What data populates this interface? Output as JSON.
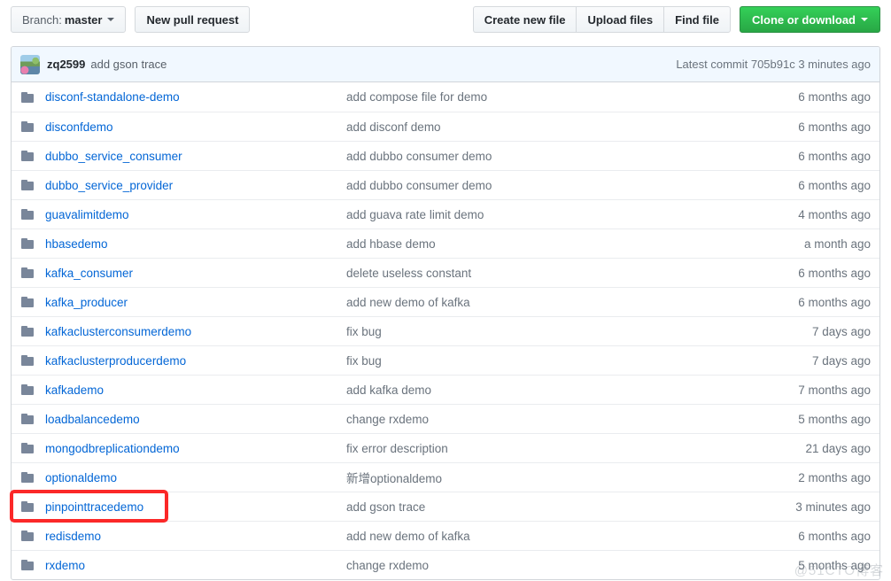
{
  "toolbar": {
    "branch_prefix": "Branch:",
    "branch_name": "master",
    "new_pull_request": "New pull request",
    "create_new_file": "Create new file",
    "upload_files": "Upload files",
    "find_file": "Find file",
    "clone_or_download": "Clone or download"
  },
  "commit_bar": {
    "author": "zq2599",
    "message": "add gson trace",
    "latest_commit_label": "Latest commit",
    "sha": "705b91c",
    "age": "3 minutes ago",
    "meta": "Latest commit 705b91c 3 minutes ago"
  },
  "files": [
    {
      "icon": "folder-icon",
      "name": "disconf-standalone-demo",
      "message": "add compose file for demo",
      "age": "6 months ago"
    },
    {
      "icon": "folder-icon",
      "name": "disconfdemo",
      "message": "add disconf demo",
      "age": "6 months ago"
    },
    {
      "icon": "folder-icon",
      "name": "dubbo_service_consumer",
      "message": "add dubbo consumer demo",
      "age": "6 months ago"
    },
    {
      "icon": "folder-icon",
      "name": "dubbo_service_provider",
      "message": "add dubbo consumer demo",
      "age": "6 months ago"
    },
    {
      "icon": "folder-icon",
      "name": "guavalimitdemo",
      "message": "add guava rate limit demo",
      "age": "4 months ago"
    },
    {
      "icon": "folder-icon",
      "name": "hbasedemo",
      "message": "add hbase demo",
      "age": "a month ago"
    },
    {
      "icon": "folder-icon",
      "name": "kafka_consumer",
      "message": "delete useless constant",
      "age": "6 months ago"
    },
    {
      "icon": "folder-icon",
      "name": "kafka_producer",
      "message": "add new demo of kafka",
      "age": "6 months ago"
    },
    {
      "icon": "folder-icon",
      "name": "kafkaclusterconsumerdemo",
      "message": "fix bug",
      "age": "7 days ago"
    },
    {
      "icon": "folder-icon",
      "name": "kafkaclusterproducerdemo",
      "message": "fix bug",
      "age": "7 days ago"
    },
    {
      "icon": "folder-icon",
      "name": "kafkademo",
      "message": "add kafka demo",
      "age": "7 months ago"
    },
    {
      "icon": "folder-icon",
      "name": "loadbalancedemo",
      "message": "change rxdemo",
      "age": "5 months ago"
    },
    {
      "icon": "folder-icon",
      "name": "mongodbreplicationdemo",
      "message": "fix error description",
      "age": "21 days ago"
    },
    {
      "icon": "folder-icon",
      "name": "optionaldemo",
      "message": "新增optionaldemo",
      "age": "2 months ago"
    },
    {
      "icon": "folder-icon",
      "name": "pinpointtracedemo",
      "message": "add gson trace",
      "age": "3 minutes ago"
    },
    {
      "icon": "folder-icon",
      "name": "redisdemo",
      "message": "add new demo of kafka",
      "age": "6 months ago"
    },
    {
      "icon": "folder-icon",
      "name": "rxdemo",
      "message": "change rxdemo",
      "age": "5 months ago"
    }
  ],
  "annotation": {
    "highlight_target": "pinpointtracedemo"
  },
  "watermark": {
    "text": "@51CTO博客"
  },
  "colors": {
    "link": "#0366d6",
    "muted": "#6a737d",
    "green_button": "#28a745",
    "commit_bar_bg": "#f1f8ff",
    "border": "#d1d5da",
    "highlight": "#fb2828",
    "folder_icon": "#79869a"
  }
}
